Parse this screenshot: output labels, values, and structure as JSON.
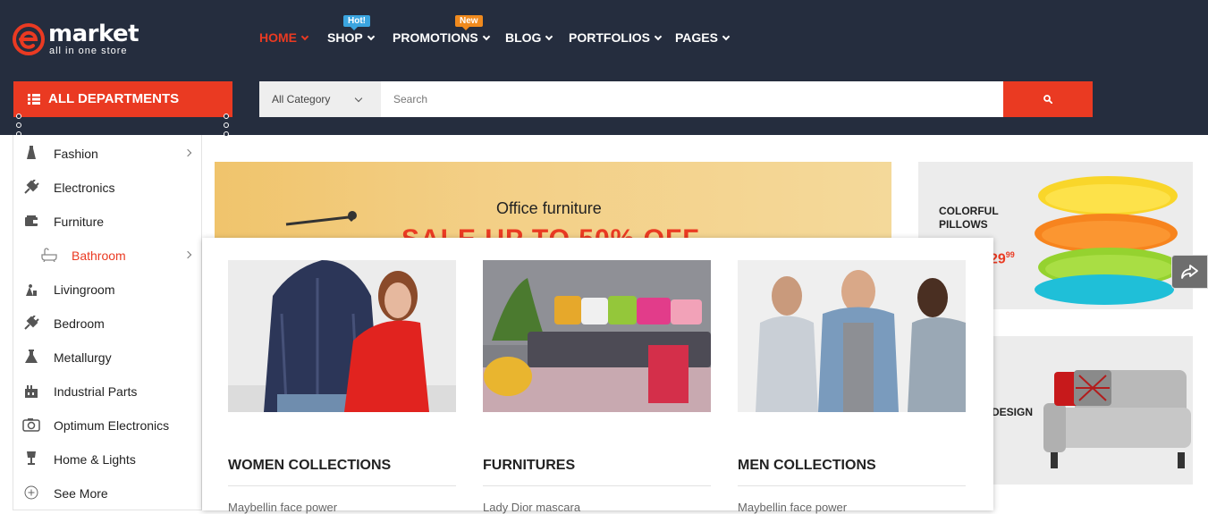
{
  "logo": {
    "name": "market",
    "tagline": "all in one store",
    "mark_letter": "e"
  },
  "nav": {
    "items": [
      {
        "label": "HOME",
        "active": true
      },
      {
        "label": "SHOP",
        "badge": "Hot!"
      },
      {
        "label": "PROMOTIONS",
        "badge": "New"
      },
      {
        "label": "BLOG"
      },
      {
        "label": "PORTFOLIOS"
      },
      {
        "label": "PAGES"
      }
    ]
  },
  "departments": {
    "label": "ALL DEPARTMENTS"
  },
  "search": {
    "category": "All Category",
    "placeholder": "Search"
  },
  "side_menu": {
    "items": [
      {
        "label": "Fashion",
        "icon": "dress-icon",
        "has_submenu": true
      },
      {
        "label": "Electronics",
        "icon": "plug-icon"
      },
      {
        "label": "Furniture",
        "icon": "wallet-icon"
      },
      {
        "label": "Bathroom",
        "icon": "bathtub-icon",
        "has_submenu": true,
        "sub": true
      },
      {
        "label": "Livingroom",
        "icon": "tools-icon"
      },
      {
        "label": "Bedroom",
        "icon": "plug-icon"
      },
      {
        "label": "Metallurgy",
        "icon": "flask-icon"
      },
      {
        "label": "Industrial Parts",
        "icon": "factory-icon"
      },
      {
        "label": "Optimum Electronics",
        "icon": "camera-icon"
      },
      {
        "label": "Home & Lights",
        "icon": "lamp-icon"
      },
      {
        "label": "See More",
        "icon": "plus-circle-icon"
      }
    ]
  },
  "banner": {
    "title": "Office furniture",
    "sale": "SALE UP TO 50% OFF"
  },
  "side_banners": {
    "pillows": {
      "line1": "COLORFUL",
      "line2": "PILLOWS",
      "price": "29",
      "price_cents": "99"
    },
    "design": {
      "label": "DESIGN"
    }
  },
  "mega_menu": {
    "columns": [
      {
        "title": "WOMEN COLLECTIONS",
        "link": "Maybellin face power"
      },
      {
        "title": "FURNITURES",
        "link": "Lady Dior mascara"
      },
      {
        "title": "MEN COLLECTIONS",
        "link": "Maybellin face power"
      }
    ]
  },
  "colors": {
    "header_bg": "#252d3e",
    "accent": "#ea3a22",
    "badge_hot": "#3ba5e0",
    "badge_new": "#f08a1e"
  }
}
